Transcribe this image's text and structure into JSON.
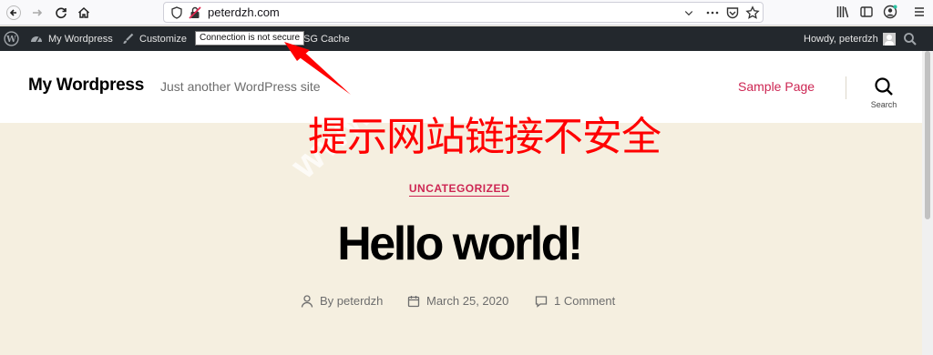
{
  "browser": {
    "url": "peterdzh.com"
  },
  "admin_bar": {
    "site_name": "My Wordpress",
    "customize": "Customize",
    "cache": "SG Cache",
    "howdy": "Howdy, peterdzh"
  },
  "tooltip": "Connection is not secure",
  "site": {
    "title": "My Wordpress",
    "description": "Just another WordPress site",
    "nav_item": "Sample Page",
    "search_label": "Search"
  },
  "annotation": "提示网站链接不安全",
  "watermark": "www.      m",
  "post": {
    "category": "UNCATEGORIZED",
    "title": "Hello world!",
    "author": "By peterdzh",
    "date": "March 25, 2020",
    "comments": "1 Comment"
  },
  "colors": {
    "accent": "#cd2653",
    "annotation": "#ff0000",
    "admin_bar": "#23282d",
    "content_bg": "#f5efe0"
  }
}
